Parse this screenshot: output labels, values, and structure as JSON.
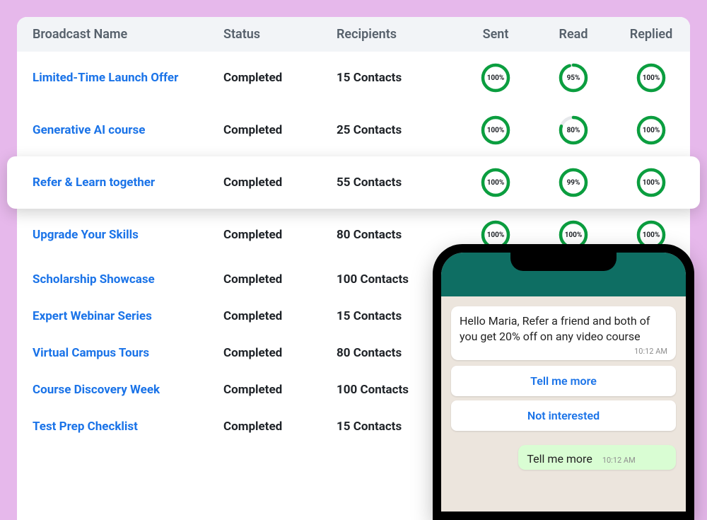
{
  "table": {
    "headers": {
      "name": "Broadcast Name",
      "status": "Status",
      "recipients": "Recipients",
      "sent": "Sent",
      "read": "Read",
      "replied": "Replied"
    },
    "rows": [
      {
        "name": "Limited-Time Launch Offer",
        "status": "Completed",
        "recipients": "15 Contacts",
        "sent": 100,
        "read": 95,
        "replied": 100,
        "highlight": false
      },
      {
        "name": "Generative AI course",
        "status": "Completed",
        "recipients": "25 Contacts",
        "sent": 100,
        "read": 80,
        "replied": 100,
        "highlight": false
      },
      {
        "name": "Refer & Learn together",
        "status": "Completed",
        "recipients": "55 Contacts",
        "sent": 100,
        "read": 99,
        "replied": 100,
        "highlight": true
      },
      {
        "name": "Upgrade Your Skills",
        "status": "Completed",
        "recipients": "80 Contacts",
        "sent": 100,
        "read": 100,
        "replied": 100,
        "highlight": false
      },
      {
        "name": "Scholarship Showcase",
        "status": "Completed",
        "recipients": "100 Contacts",
        "sent": null,
        "read": null,
        "replied": null,
        "highlight": false
      },
      {
        "name": "Expert Webinar Series",
        "status": "Completed",
        "recipients": "15 Contacts",
        "sent": null,
        "read": null,
        "replied": null,
        "highlight": false
      },
      {
        "name": "Virtual Campus Tours",
        "status": "Completed",
        "recipients": "80 Contacts",
        "sent": null,
        "read": null,
        "replied": null,
        "highlight": false
      },
      {
        "name": "Course Discovery Week",
        "status": "Completed",
        "recipients": "100 Contacts",
        "sent": null,
        "read": null,
        "replied": null,
        "highlight": false
      },
      {
        "name": "Test Prep Checklist",
        "status": "Completed",
        "recipients": "15 Contacts",
        "sent": null,
        "read": null,
        "replied": null,
        "highlight": false
      }
    ]
  },
  "colors": {
    "ring_track": "#e6e8eb",
    "ring_bar": "#0b9e3f",
    "link": "#1a73e8",
    "whatsapp_header": "#0e6e63"
  },
  "phone": {
    "message": {
      "text": "Hello Maria, Refer a friend and both of you get 20% off on any video course",
      "time": "10:12 AM"
    },
    "quick_replies": [
      "Tell me more",
      "Not interested"
    ],
    "reply": {
      "text": "Tell me more",
      "time": "10:12 AM"
    }
  }
}
